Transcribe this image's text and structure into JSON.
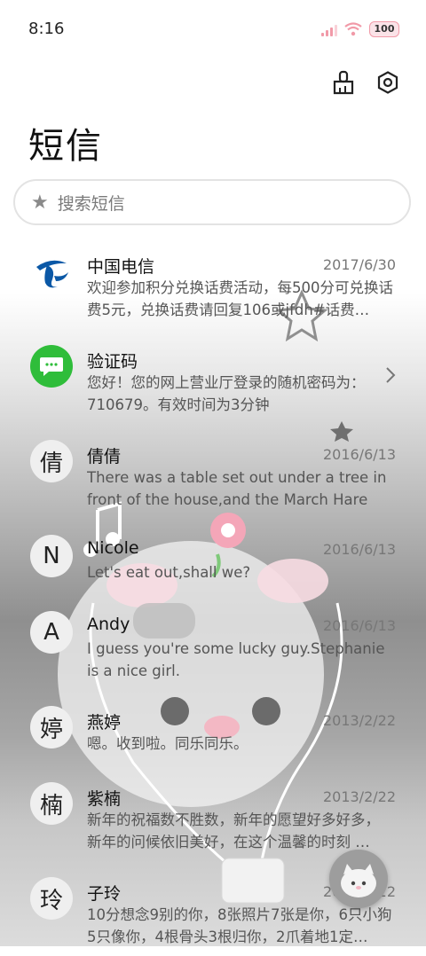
{
  "status_bar": {
    "time": "8:16",
    "battery": "100"
  },
  "page_title": "短信",
  "search": {
    "placeholder": "搜索短信"
  },
  "conversations": [
    {
      "avatar": "",
      "avatar_icon": "china-telecom-logo-icon",
      "name": "中国电信",
      "date": "2017/6/30",
      "preview": "欢迎参加积分兑换话费活动，每500分可兑换话费5元，兑换话费请回复106或jfdh#话费…"
    },
    {
      "avatar": "",
      "avatar_icon": "green-chat-bubble-icon",
      "name": "验证码",
      "date": "",
      "preview": "您好！您的网上营业厅登录的随机密码为：710679。有效时间为3分钟"
    },
    {
      "avatar": "倩",
      "name": "倩倩",
      "date": "2016/6/13",
      "preview": "There was a table set out under a tree in front of the house,and the March Hare an…"
    },
    {
      "avatar": "N",
      "name": "Nicole",
      "date": "2016/6/13",
      "preview": "Let's eat out,shall we?"
    },
    {
      "avatar": "A",
      "name": "Andy",
      "date": "2016/6/13",
      "preview": "I guess you're some lucky guy.Stephanie is a nice girl."
    },
    {
      "avatar": "婷",
      "name": "燕婷",
      "date": "2013/2/22",
      "preview": "嗯。收到啦。同乐同乐。"
    },
    {
      "avatar": "楠",
      "name": "紫楠",
      "date": "2013/2/22",
      "preview": "新年的祝福数不胜数，新年的愿望好多好多，新年的问候依旧美好，在这个温馨的时刻 …"
    },
    {
      "avatar": "玲",
      "name": "子玲",
      "date": "2013/2/22",
      "preview": "10分想念9别的你，8张照片7张是你，6只小狗5只像你，4根骨头3根归你，2爪着地1定…"
    }
  ],
  "colors": {
    "accent_pink": "#f19aa8",
    "telecom_blue": "#0b58a6",
    "chat_green": "#2fbd3a"
  }
}
